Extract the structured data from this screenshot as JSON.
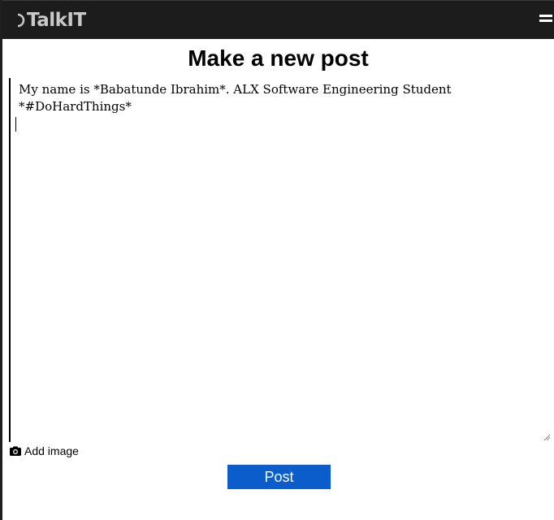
{
  "header": {
    "logo_text": "TalkIT",
    "menu_icon": "hamburger-menu-icon"
  },
  "main": {
    "title": "Make a new post",
    "post_text": "My name is *Babatunde Ibrahim*. ALX Software Engineering Student\n*#DoHardThings*\n",
    "add_image_icon": "camera-icon",
    "add_image_label": "Add image",
    "post_button_label": "Post"
  },
  "colors": {
    "topbar_bg": "#1c1c1c",
    "logo": "#c9c9c9",
    "post_button_bg": "#0a5dcb"
  }
}
